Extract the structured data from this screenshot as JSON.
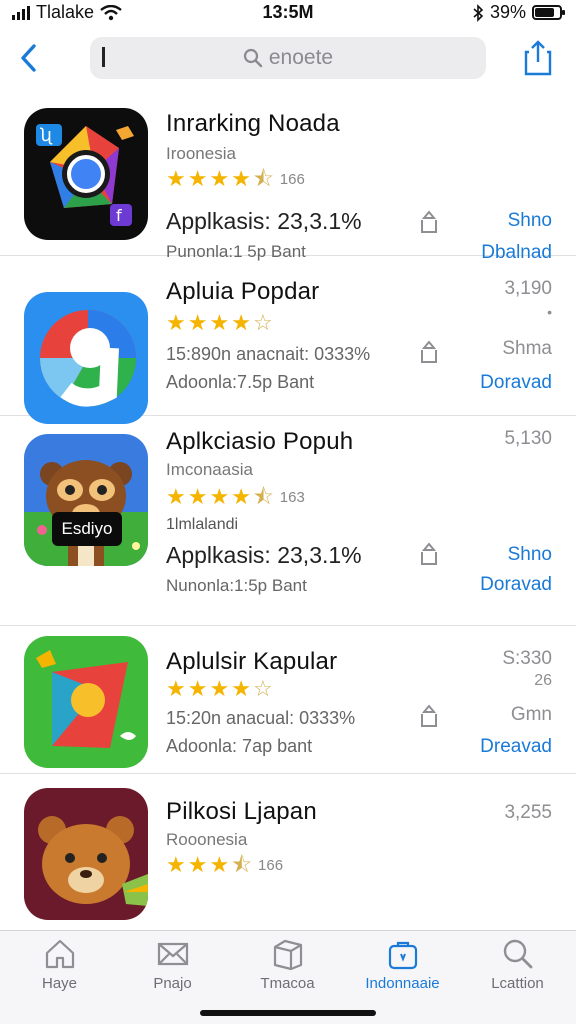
{
  "status": {
    "carrier": "Tlalake",
    "time": "13:5M",
    "battery": "39%",
    "battery_level": 0.85
  },
  "nav": {
    "search_query": "enoete",
    "icons": [
      "back-chevron-icon",
      "search-icon",
      "share-icon"
    ]
  },
  "apps": [
    {
      "name": "Inrarking Noada",
      "subtitle": "Iroonesia",
      "rating": 4.5,
      "rating_count": "166",
      "description": "Applkasis: 23,3.1%",
      "meta": "Punonla:1 5p Bant",
      "side_top": "",
      "side_action": "Shno",
      "side_download": "Dbalnad"
    },
    {
      "name": "Apluia Popdar",
      "subtitle": "",
      "rating": 4.5,
      "rating_count": "",
      "description": "15:890n anacnait: 0333%",
      "meta": "Adoonla:7.5p Bant",
      "side_top": "3,190",
      "side_dot": "•",
      "side_action": "Shma",
      "side_download": "Doravad"
    },
    {
      "name": "Aplkciasio Popuh",
      "subtitle": "Imconaasia",
      "rating": 4.5,
      "rating_count": "163",
      "extra_line": "1lmlalandi",
      "description": "Applkasis: 23,3.1%",
      "meta": "Nunonla:1:5p Bant",
      "side_top": "5,130",
      "side_action": "Shno",
      "side_download": "Doravad",
      "badge": "Esdiyo"
    },
    {
      "name": "Aplulsir Kapular",
      "subtitle": "",
      "rating": 4.5,
      "rating_count": "",
      "description": "15:20n anacual: 0333%",
      "meta": "Adoonla: 7ap bant",
      "side_top": "S:330",
      "side_sub": "26",
      "side_action": "Gmn",
      "side_download": "Dreavad"
    },
    {
      "name": "Pilkosi Ljapan",
      "subtitle": "Rooonesia",
      "rating": 4,
      "rating_count": "166",
      "description": "",
      "meta": "",
      "side_top": "3,255",
      "side_action": "",
      "side_download": ""
    }
  ],
  "tabs": [
    {
      "label": "Haye",
      "icon": "house-icon"
    },
    {
      "label": "Pnajo",
      "icon": "envelope-icon"
    },
    {
      "label": "Tmacoa",
      "icon": "box-icon"
    },
    {
      "label": "Indonnaaie",
      "icon": "bag-icon",
      "active": true
    },
    {
      "label": "Lcattion",
      "icon": "search-icon"
    }
  ],
  "colors": {
    "accent": "#1a7ad8",
    "star": "#f4b400"
  }
}
